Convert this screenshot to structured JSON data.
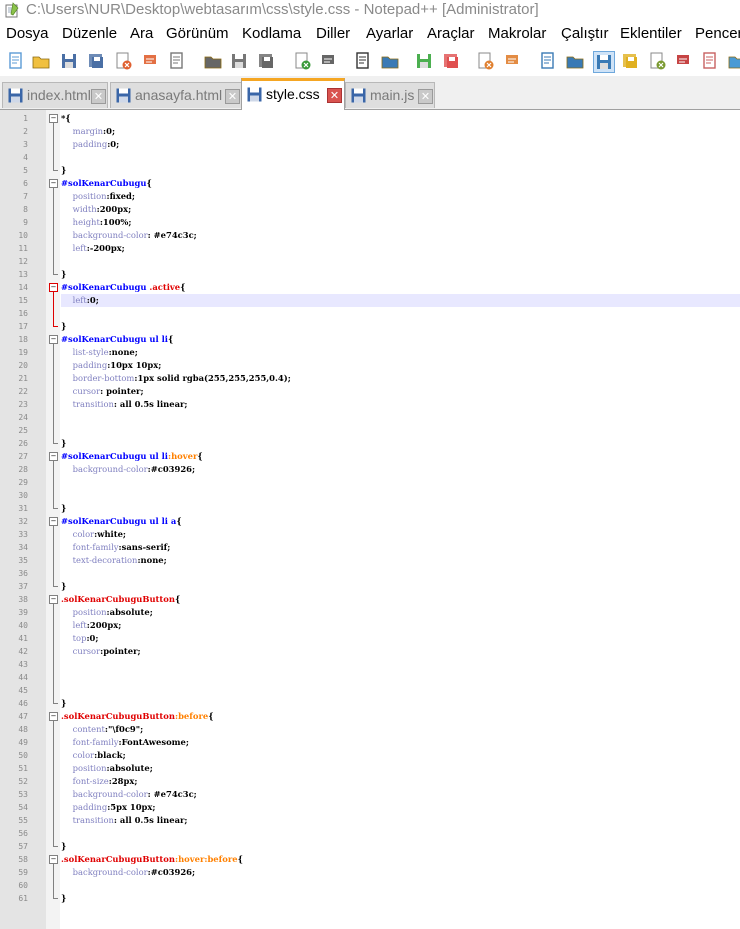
{
  "window": {
    "title": "C:\\Users\\NUR\\Desktop\\webtasarım\\css\\style.css - Notepad++ [Administrator]"
  },
  "menu": [
    "Dosya",
    "Düzenle",
    "Ara",
    "Görünüm",
    "Kodlama",
    "Diller",
    "Ayarlar",
    "Araçlar",
    "Makrolar",
    "Çalıştır",
    "Eklentiler",
    "Pencere"
  ],
  "toolbar_icons": [
    "new-file-icon",
    "open-file-icon",
    "save-icon",
    "save-all-icon",
    "close-icon",
    "close-all-icon",
    "print-icon",
    "cut-icon",
    "copy-icon",
    "paste-icon",
    "undo-icon",
    "redo-icon",
    "find-icon",
    "replace-icon",
    "zoom-in-icon",
    "zoom-out-icon",
    "sync-v-icon",
    "sync-h-icon",
    "word-wrap-icon",
    "show-all-chars-icon",
    "indent-guide-icon",
    "user-lang-icon",
    "doc-map-icon",
    "function-list-icon",
    "folder-workspace-icon",
    "monitor-icon"
  ],
  "tabs": [
    {
      "label": "index.html",
      "active": false
    },
    {
      "label": "anasayfa.html",
      "active": false
    },
    {
      "label": "style.css",
      "active": true
    },
    {
      "label": "main.js",
      "active": false
    }
  ],
  "colors": {
    "selector_id": "#0000ff",
    "selector_class": "#e00000",
    "pseudo_class": "#ff8000",
    "property": "#8080c0",
    "value": "#000000",
    "current_line": "#e8e8ff",
    "active_tab_accent": "#f5a623"
  },
  "lines": [
    [
      [
        "sel",
        "*{"
      ]
    ],
    [
      [
        "ind",
        "    "
      ],
      [
        "prop",
        "margin"
      ],
      [
        "val",
        ":0;"
      ]
    ],
    [
      [
        "ind",
        "    "
      ],
      [
        "prop",
        "padding"
      ],
      [
        "val",
        ":0;"
      ]
    ],
    [],
    [
      [
        "sel",
        "}"
      ]
    ],
    [
      [
        "id",
        "#solKenarCubugu"
      ],
      [
        "sel",
        "{"
      ]
    ],
    [
      [
        "ind",
        "    "
      ],
      [
        "prop",
        "position"
      ],
      [
        "val",
        ":fixed;"
      ]
    ],
    [
      [
        "ind",
        "    "
      ],
      [
        "prop",
        "width"
      ],
      [
        "val",
        ":200px;"
      ]
    ],
    [
      [
        "ind",
        "    "
      ],
      [
        "prop",
        "height"
      ],
      [
        "val",
        ":100%;"
      ]
    ],
    [
      [
        "ind",
        "    "
      ],
      [
        "prop",
        "background-color"
      ],
      [
        "val",
        ": #e74c3c;"
      ]
    ],
    [
      [
        "ind",
        "    "
      ],
      [
        "prop",
        "left"
      ],
      [
        "val",
        ":-200px;"
      ]
    ],
    [],
    [
      [
        "sel",
        "}"
      ]
    ],
    [
      [
        "id",
        "#solKenarCubugu "
      ],
      [
        "cls",
        ".active"
      ],
      [
        "sel",
        "{"
      ]
    ],
    [
      [
        "ind",
        "    "
      ],
      [
        "prop",
        "left"
      ],
      [
        "val",
        ":0;"
      ]
    ],
    [],
    [
      [
        "sel",
        "}"
      ]
    ],
    [
      [
        "id",
        "#solKenarCubugu "
      ],
      [
        "id",
        "ul li"
      ],
      [
        "sel",
        "{"
      ]
    ],
    [
      [
        "ind",
        "    "
      ],
      [
        "prop",
        "list-style"
      ],
      [
        "val",
        ":none;"
      ]
    ],
    [
      [
        "ind",
        "    "
      ],
      [
        "prop",
        "padding"
      ],
      [
        "val",
        ":10px 10px;"
      ]
    ],
    [
      [
        "ind",
        "    "
      ],
      [
        "prop",
        "border-bottom"
      ],
      [
        "val",
        ":1px solid rgba(255,255,255,0.4);"
      ]
    ],
    [
      [
        "ind",
        "    "
      ],
      [
        "prop",
        "cursor"
      ],
      [
        "val",
        ": pointer;"
      ]
    ],
    [
      [
        "ind",
        "    "
      ],
      [
        "prop",
        "transition"
      ],
      [
        "val",
        ": all 0.5s linear;"
      ]
    ],
    [],
    [],
    [
      [
        "sel",
        "}"
      ]
    ],
    [
      [
        "id",
        "#solKenarCubugu "
      ],
      [
        "id",
        "ul li"
      ],
      [
        "pc",
        ":hover"
      ],
      [
        "sel",
        "{"
      ]
    ],
    [
      [
        "ind",
        "    "
      ],
      [
        "prop",
        "background-color"
      ],
      [
        "val",
        ":#c03926;"
      ]
    ],
    [],
    [],
    [
      [
        "sel",
        "}"
      ]
    ],
    [
      [
        "id",
        "#solKenarCubugu "
      ],
      [
        "id",
        "ul li a"
      ],
      [
        "sel",
        "{"
      ]
    ],
    [
      [
        "ind",
        "    "
      ],
      [
        "prop",
        "color"
      ],
      [
        "val",
        ":white;"
      ]
    ],
    [
      [
        "ind",
        "    "
      ],
      [
        "prop",
        "font-family"
      ],
      [
        "val",
        ":sans-serif;"
      ]
    ],
    [
      [
        "ind",
        "    "
      ],
      [
        "prop",
        "text-decoration"
      ],
      [
        "val",
        ":none;"
      ]
    ],
    [],
    [
      [
        "sel",
        "}"
      ]
    ],
    [
      [
        "cls",
        ".solKenarCubuguButton"
      ],
      [
        "sel",
        "{"
      ]
    ],
    [
      [
        "ind",
        "    "
      ],
      [
        "prop",
        "position"
      ],
      [
        "val",
        ":absolute;"
      ]
    ],
    [
      [
        "ind",
        "    "
      ],
      [
        "prop",
        "left"
      ],
      [
        "val",
        ":200px;"
      ]
    ],
    [
      [
        "ind",
        "    "
      ],
      [
        "prop",
        "top"
      ],
      [
        "val",
        ":0;"
      ]
    ],
    [
      [
        "ind",
        "    "
      ],
      [
        "prop",
        "cursor"
      ],
      [
        "val",
        ":pointer;"
      ]
    ],
    [],
    [],
    [],
    [
      [
        "sel",
        "}"
      ]
    ],
    [
      [
        "cls",
        ".solKenarCubuguButton"
      ],
      [
        "pc",
        ":before"
      ],
      [
        "sel",
        "{"
      ]
    ],
    [
      [
        "ind",
        "    "
      ],
      [
        "prop",
        "content"
      ],
      [
        "val",
        ":\"\\f0c9\";"
      ]
    ],
    [
      [
        "ind",
        "    "
      ],
      [
        "prop",
        "font-family"
      ],
      [
        "val",
        ":FontAwesome;"
      ]
    ],
    [
      [
        "ind",
        "    "
      ],
      [
        "prop",
        "color"
      ],
      [
        "val",
        ":black;"
      ]
    ],
    [
      [
        "ind",
        "    "
      ],
      [
        "prop",
        "position"
      ],
      [
        "val",
        ":absolute;"
      ]
    ],
    [
      [
        "ind",
        "    "
      ],
      [
        "prop",
        "font-size"
      ],
      [
        "val",
        ":28px;"
      ]
    ],
    [
      [
        "ind",
        "    "
      ],
      [
        "prop",
        "background-color"
      ],
      [
        "val",
        ": #e74c3c;"
      ]
    ],
    [
      [
        "ind",
        "    "
      ],
      [
        "prop",
        "padding"
      ],
      [
        "val",
        ":5px 10px;"
      ]
    ],
    [
      [
        "ind",
        "    "
      ],
      [
        "prop",
        "transition"
      ],
      [
        "val",
        ": all 0.5s linear;"
      ]
    ],
    [],
    [
      [
        "sel",
        "}"
      ]
    ],
    [
      [
        "cls",
        ".solKenarCubuguButton"
      ],
      [
        "pc",
        ":hover:before"
      ],
      [
        "sel",
        "{"
      ]
    ],
    [
      [
        "ind",
        "    "
      ],
      [
        "prop",
        "background-color"
      ],
      [
        "val",
        ":#c03926;"
      ]
    ],
    [],
    [
      [
        "sel",
        "}"
      ]
    ]
  ],
  "current_line": 15
}
